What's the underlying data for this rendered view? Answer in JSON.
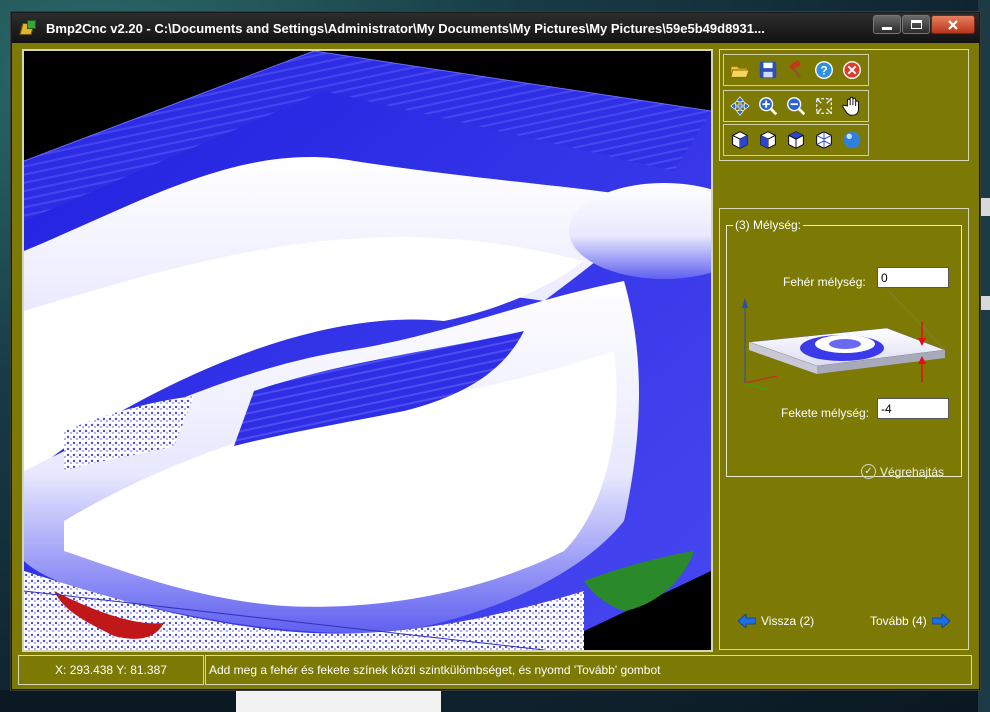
{
  "window": {
    "title": "Bmp2Cnc v2.20 - C:\\Documents and Settings\\Administrator\\My Documents\\My Pictures\\My Pictures\\59e5b49d8931..."
  },
  "toolbar": {
    "rows": [
      [
        {
          "name": "open-folder-icon",
          "color": "#e8c23a"
        },
        {
          "name": "save-disk-icon",
          "color": "#2a4fb8"
        },
        {
          "name": "hammer-icon",
          "color": "#c8361b"
        },
        {
          "name": "help-icon",
          "color": "#2f8fe0"
        },
        {
          "name": "close-circle-icon",
          "color": "#e03a2a"
        }
      ],
      [
        {
          "name": "move-arrows-icon",
          "color": "#2a63d6"
        },
        {
          "name": "zoom-in-icon",
          "color": "#2a63d6"
        },
        {
          "name": "zoom-out-icon",
          "color": "#2a63d6"
        },
        {
          "name": "zoom-fit-icon",
          "color": "#e8e8e8"
        },
        {
          "name": "pan-hand-icon",
          "color": "#ffffff"
        }
      ],
      [
        {
          "name": "view-cube-front-icon",
          "color": "#2a46d0"
        },
        {
          "name": "view-cube-side-icon",
          "color": "#2a46d0"
        },
        {
          "name": "view-cube-top-icon",
          "color": "#2a46d0"
        },
        {
          "name": "view-cube-wire-icon",
          "color": "#2a46d0"
        },
        {
          "name": "render-sphere-icon",
          "color": "#2f7fe0"
        }
      ]
    ]
  },
  "depth_panel": {
    "legend": "(3) Mélység:",
    "white_label": "Fehér mélység:",
    "white_value": "0",
    "black_label": "Fekete mélység:",
    "black_value": "-4",
    "execute_label": "Végrehajtás"
  },
  "nav": {
    "back_label": "Vissza (2)",
    "next_label": "Tovább (4)"
  },
  "status": {
    "coords": "X: 293.438 Y: 81.387",
    "message": "Add meg a fehér és fekete színek közti szintkülömbséget, és nyomd 'Tovább' gombot"
  },
  "colors": {
    "window_bg": "#7c7a05",
    "mesh_blue": "#2a2ae8",
    "mesh_white": "#ffffff",
    "arrow_red": "#e01010",
    "nav_arrow_blue": "#1d6fe8"
  }
}
